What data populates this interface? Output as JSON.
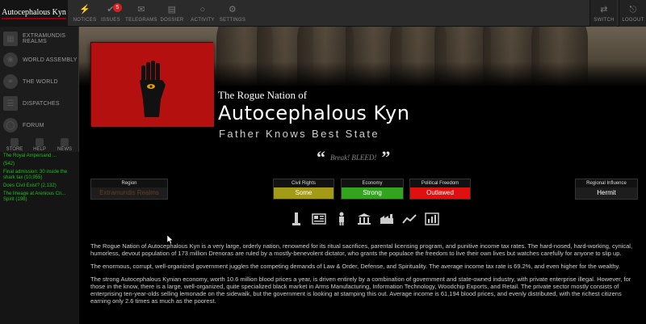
{
  "logo": {
    "text": "Autocephalous Kyn"
  },
  "nav": {
    "items": [
      {
        "label": "NOTICES",
        "icon": "lightning-icon"
      },
      {
        "label": "ISSUES",
        "icon": "checkmark-icon",
        "badge": "5"
      },
      {
        "label": "TELEGRAMS",
        "icon": "envelope-icon"
      },
      {
        "label": "DOSSIER",
        "icon": "folder-icon"
      },
      {
        "label": "ACTIVITY",
        "icon": "signal-icon"
      },
      {
        "label": "SETTINGS",
        "icon": "gear-icon"
      }
    ],
    "switch_label": "SWITCH",
    "logout_label": "LOGOUT"
  },
  "sidebar": {
    "items": [
      {
        "label": "EXTRAMUNDIS REALMS",
        "icon": "map-icon"
      },
      {
        "label": "WORLD ASSEMBLY",
        "icon": "laurel-icon"
      },
      {
        "label": "THE WORLD",
        "icon": "globe-icon"
      },
      {
        "label": "DISPATCHES",
        "icon": "document-icon"
      },
      {
        "label": "FORUM",
        "icon": "chat-icon"
      }
    ],
    "buttons": [
      "STORE",
      "HELP",
      "NEWS"
    ],
    "feed": [
      "The Royal Ampersand ...",
      "(542)",
      "Final admission: 30 inside the shark tax (10,955)",
      "Does Civil Exist? (2,132)",
      "The lineage at Arenious Cn... Spirit (198)"
    ]
  },
  "nation": {
    "pretitle": "The Rogue Nation of",
    "name": "Autocephalous Kyn",
    "classification": "Father Knows Best State",
    "motto": "Break! BLEED!"
  },
  "stats": {
    "region_label": "Region",
    "region_value": "Extramundis Realms",
    "civil_label": "Civil Rights",
    "civil_value": "Some",
    "economy_label": "Economy",
    "economy_value": "Strong",
    "freedom_label": "Political Freedom",
    "freedom_value": "Outlawed",
    "influence_label": "Regional Influence",
    "influence_value": "Hermit"
  },
  "colors": {
    "civil": "#a39a17",
    "economy": "#32a41e",
    "freedom": "#e01010",
    "flag": "#b51010"
  },
  "icon_row": [
    "monument-icon",
    "newspaper-icon",
    "person-icon",
    "government-icon",
    "factory-icon",
    "trend-icon",
    "bar-chart-icon"
  ],
  "description": {
    "p1": "The Rogue Nation of Autocephalous Kyn is a very large, orderly nation, renowned for its ritual sacrifices, parental licensing program, and punitive income tax rates. The hard-nosed, hard-working, cynical, humorless, devout population of 173 million Drenoras are ruled by a mostly-benevolent dictator, who grants the populace the freedom to live their own lives but watches carefully for anyone to slip up.",
    "p2": "The enormous, corrupt, well-organized government juggles the competing demands of Law & Order, Defense, and Spirituality. The average income tax rate is 69.2%, and even higher for the wealthy.",
    "p3": "The strong Autocephalous Kynian economy, worth 10.6 million blood prices a year, is driven entirely by a combination of government and state-owned industry, with private enterprise illegal. However, for those in the know, there is a large, well-organized, quite specialized black market in Arms Manufacturing, Information Technology, Woodchip Exports, and Retail. The private sector mostly consists of enterprising ten-year-olds selling lemonade on the sidewalk, but the government is looking at stamping this out. Average income is 61,194 blood prices, and evenly distributed, with the richest citizens earning only 2.6 times as much as the poorest."
  }
}
